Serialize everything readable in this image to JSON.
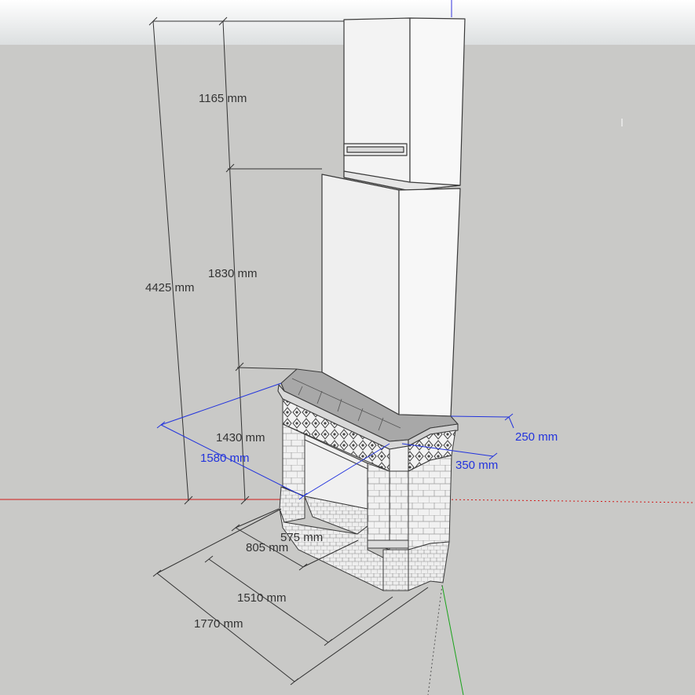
{
  "colors": {
    "ground": "#c9c9c7",
    "sky_top": "#ffffff",
    "sky_bottom": "#dcdfe0",
    "dimension_black": "#333333",
    "dimension_blue": "#2233dd",
    "axis_red": "#d11a1a",
    "axis_green": "#1aa31a",
    "axis_blue": "#3333dd",
    "face_light": "#f4f4f4",
    "face_shade": "#e2e2e2",
    "edge": "#3a3a3a"
  },
  "model": {
    "name": "corner fireplace with chimney hood",
    "components": [
      "upper-hood",
      "lower-hood",
      "mantel-shelf",
      "ornamental-frieze",
      "left-pillar",
      "right-pillar",
      "firebox-opening",
      "base-plinth"
    ]
  },
  "dimensions": {
    "total_height": "4425 mm",
    "upper_hood_height": "1165 mm",
    "lower_hood_height": "1830 mm",
    "mantel_height": "1430 mm",
    "mantel_width": "1580 mm",
    "shelf_depth_right": "250 mm",
    "shelf_depth_front": "350 mm",
    "inner_depth": "575 mm",
    "side_depth": "805 mm",
    "front_width_inner": "1510 mm",
    "front_width_outer": "1770 mm"
  }
}
